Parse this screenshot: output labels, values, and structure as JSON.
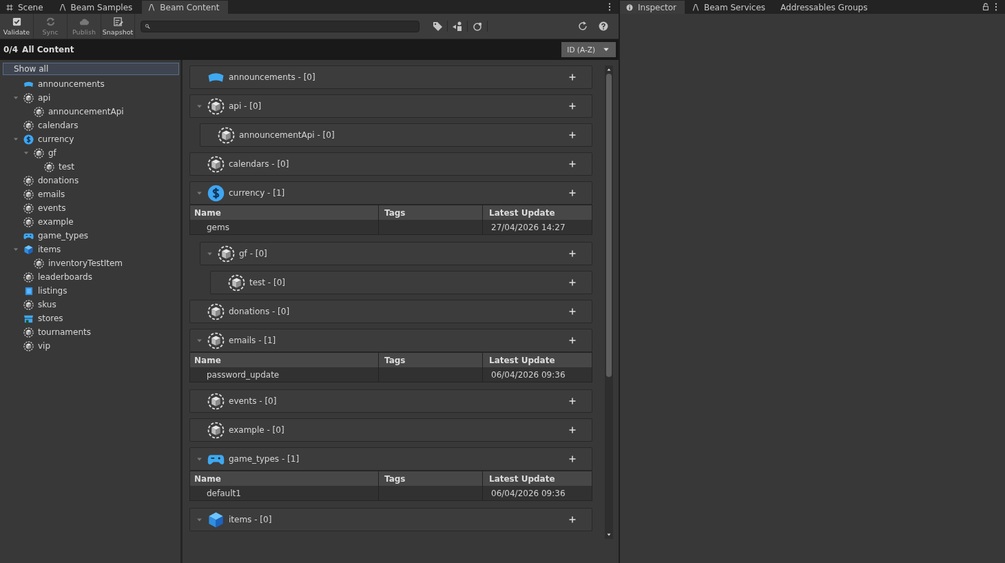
{
  "left_tabs": [
    {
      "label": "Scene",
      "selected": false
    },
    {
      "label": "Beam Samples",
      "selected": false
    },
    {
      "label": "Beam Content",
      "selected": true
    }
  ],
  "right_tabs": [
    {
      "label": "Inspector",
      "selected": true
    },
    {
      "label": "Beam Services",
      "selected": false
    },
    {
      "label": "Addressables Groups",
      "selected": false
    }
  ],
  "toolbar": {
    "buttons": [
      {
        "label": "Validate",
        "disabled": false
      },
      {
        "label": "Sync",
        "disabled": true
      },
      {
        "label": "Publish",
        "disabled": true
      },
      {
        "label": "Snapshot",
        "disabled": false
      }
    ]
  },
  "header": {
    "count": "0/4",
    "title": "All Content",
    "sort": "ID (A-Z)"
  },
  "sidebar": {
    "show_all": {
      "label": "Show all",
      "selected": true
    },
    "items": [
      {
        "label": "announcements",
        "kind": "banner"
      },
      {
        "label": "api",
        "kind": "cube",
        "expanded": true,
        "children": [
          {
            "label": "announcementApi",
            "kind": "cube"
          }
        ]
      },
      {
        "label": "calendars",
        "kind": "cube"
      },
      {
        "label": "currency",
        "kind": "dollar",
        "expanded": true,
        "children": [
          {
            "label": "gf",
            "kind": "cube",
            "expanded": true,
            "children": [
              {
                "label": "test",
                "kind": "cube"
              }
            ]
          }
        ]
      },
      {
        "label": "donations",
        "kind": "cube"
      },
      {
        "label": "emails",
        "kind": "cube"
      },
      {
        "label": "events",
        "kind": "cube"
      },
      {
        "label": "example",
        "kind": "cube"
      },
      {
        "label": "game_types",
        "kind": "gamepad"
      },
      {
        "label": "items",
        "kind": "bluecube",
        "expanded": true,
        "children": [
          {
            "label": "inventoryTestItem",
            "kind": "cube"
          }
        ]
      },
      {
        "label": "leaderboards",
        "kind": "cube"
      },
      {
        "label": "listings",
        "kind": "listing"
      },
      {
        "label": "skus",
        "kind": "cube"
      },
      {
        "label": "stores",
        "kind": "store"
      },
      {
        "label": "tournaments",
        "kind": "cube"
      },
      {
        "label": "vip",
        "kind": "cube"
      }
    ]
  },
  "groups": [
    {
      "label": "announcements - [0]",
      "kind": "banner"
    },
    {
      "label": "api - [0]",
      "kind": "cube",
      "expanded": true,
      "children": [
        {
          "label": "announcementApi - [0]",
          "kind": "cube"
        }
      ]
    },
    {
      "label": "calendars - [0]",
      "kind": "cube"
    },
    {
      "label": "currency - [1]",
      "kind": "dollar",
      "expanded": true,
      "table": {
        "columns": [
          "Name",
          "Tags",
          "Latest Update"
        ],
        "rows": [
          {
            "name": "gems",
            "latest_update": "27/04/2026 14:27"
          }
        ]
      },
      "children": [
        {
          "label": "gf - [0]",
          "kind": "cube",
          "expanded": true,
          "children": [
            {
              "label": "test - [0]",
              "kind": "cube"
            }
          ]
        }
      ]
    },
    {
      "label": "donations - [0]",
      "kind": "cube"
    },
    {
      "label": "emails - [1]",
      "kind": "cube",
      "expanded": true,
      "table": {
        "columns": [
          "Name",
          "Tags",
          "Latest Update"
        ],
        "rows": [
          {
            "name": "password_update",
            "latest_update": "06/04/2026 09:36"
          }
        ]
      }
    },
    {
      "label": "events - [0]",
      "kind": "cube"
    },
    {
      "label": "example - [0]",
      "kind": "cube"
    },
    {
      "label": "game_types - [1]",
      "kind": "gamepad",
      "expanded": true,
      "table": {
        "columns": [
          "Name",
          "Tags",
          "Latest Update"
        ],
        "rows": [
          {
            "name": "default1",
            "latest_update": "06/04/2026 09:36"
          }
        ]
      }
    },
    {
      "label": "items - [0]",
      "kind": "bluecube",
      "expanded": true
    }
  ]
}
